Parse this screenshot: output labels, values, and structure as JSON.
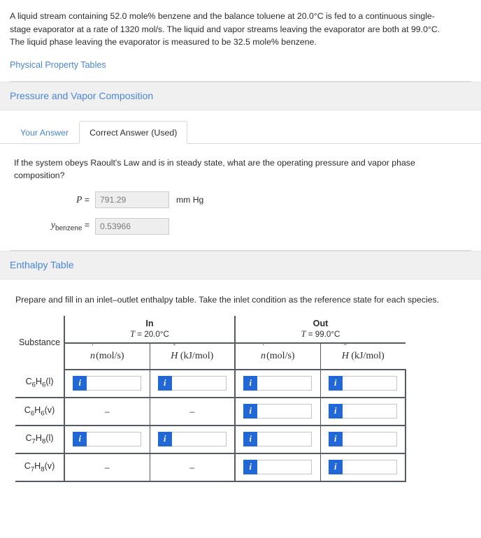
{
  "problem": {
    "statement": "A liquid stream containing 52.0 mole% benzene and the balance toluene at 20.0°C is fed to a continuous single-stage evaporator at a rate of 1320 mol/s. The liquid and vapor streams leaving the evaporator are both at 99.0°C. The liquid phase leaving the evaporator is measured to be 32.5 mole% benzene.",
    "property_tables_link": "Physical Property Tables"
  },
  "section_pressure": {
    "title": "Pressure and Vapor Composition",
    "tabs": [
      {
        "label": "Your Answer",
        "active": false
      },
      {
        "label": "Correct Answer (Used)",
        "active": true
      }
    ],
    "question": "If the system obeys Raoult's Law and is in steady state, what are the operating pressure and vapor phase composition?",
    "fields": [
      {
        "label_main": "P",
        "label_sub": "",
        "equals": "=",
        "value": "791.29",
        "unit": "mm Hg"
      },
      {
        "label_main": "y",
        "label_sub": "benzene",
        "equals": "=",
        "value": "0.53966",
        "unit": ""
      }
    ]
  },
  "section_enthalpy": {
    "title": "Enthalpy Table",
    "intro": "Prepare and fill in an inlet–outlet enthalpy table. Take the inlet condition as the reference state for each species.",
    "table": {
      "substance_header": "Substance",
      "groups": [
        {
          "name": "In",
          "temperature": "T = 20.0°C"
        },
        {
          "name": "Out",
          "temperature": "T = 99.0°C"
        }
      ],
      "column_headers": [
        {
          "var": "n",
          "accent": "˙",
          "units": "(mol/s)"
        },
        {
          "var": "H",
          "accent": "ˆ",
          "units": "(kJ/mol)"
        },
        {
          "var": "n",
          "accent": "˙",
          "units": "(mol/s)"
        },
        {
          "var": "H",
          "accent": "ˆ",
          "units": "(kJ/mol)"
        }
      ],
      "dash": "–",
      "info_icon_label": "i",
      "rows": [
        {
          "species": "C6H6",
          "phase": "(l)",
          "cells": [
            {
              "type": "input",
              "value": ""
            },
            {
              "type": "input",
              "value": ""
            },
            {
              "type": "input",
              "value": ""
            },
            {
              "type": "input",
              "value": ""
            }
          ]
        },
        {
          "species": "C6H6",
          "phase": "(v)",
          "cells": [
            {
              "type": "dash",
              "value": "–"
            },
            {
              "type": "dash",
              "value": "–"
            },
            {
              "type": "input",
              "value": ""
            },
            {
              "type": "input",
              "value": ""
            }
          ]
        },
        {
          "species": "C7H8",
          "phase": "(l)",
          "cells": [
            {
              "type": "input",
              "value": ""
            },
            {
              "type": "input",
              "value": ""
            },
            {
              "type": "input",
              "value": ""
            },
            {
              "type": "input",
              "value": ""
            }
          ]
        },
        {
          "species": "C7H8",
          "phase": "(v)",
          "cells": [
            {
              "type": "dash",
              "value": "–"
            },
            {
              "type": "dash",
              "value": "–"
            },
            {
              "type": "input",
              "value": ""
            },
            {
              "type": "input",
              "value": ""
            }
          ]
        }
      ]
    }
  },
  "colors": {
    "link_blue": "#4a86d8",
    "info_blue": "#2167d6",
    "section_bar_bg": "#f0f0f0",
    "table_border": "#555b63",
    "readonly_bg": "#eeeeee"
  }
}
